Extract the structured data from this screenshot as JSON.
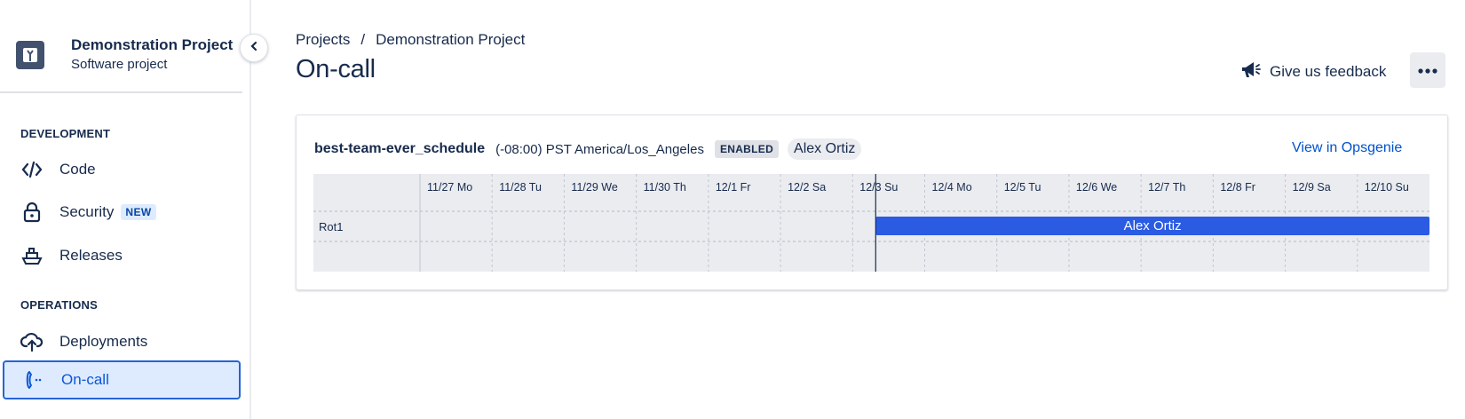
{
  "project": {
    "name": "Demonstration Project",
    "type": "Software project"
  },
  "sidebar": {
    "sections": [
      {
        "heading": "DEVELOPMENT"
      },
      {
        "heading": "OPERATIONS"
      }
    ],
    "items": [
      {
        "label": "Code",
        "icon": "code-icon"
      },
      {
        "label": "Security",
        "icon": "lock-icon",
        "badge": "NEW"
      },
      {
        "label": "Releases",
        "icon": "ship-icon"
      },
      {
        "label": "Deployments",
        "icon": "cloud-upload-icon"
      },
      {
        "label": "On-call",
        "icon": "phone-icon",
        "active": true
      }
    ]
  },
  "breadcrumb": {
    "items": [
      "Projects",
      "Demonstration Project"
    ],
    "separator": "/"
  },
  "page": {
    "title": "On-call",
    "feedback_label": "Give us feedback"
  },
  "schedule": {
    "name": "best-team-ever_schedule",
    "timezone": "(-08:00) PST America/Los_Angeles",
    "status": "ENABLED",
    "on_call_person": "Alex Ortiz",
    "link_label": "View in Opsgenie",
    "days": [
      "11/27 Mo",
      "11/28 Tu",
      "11/29 We",
      "11/30 Th",
      "12/1 Fr",
      "12/2 Sa",
      "12/3 Su",
      "12/4 Mo",
      "12/5 Tu",
      "12/6 We",
      "12/7 Th",
      "12/8 Fr",
      "12/9 Sa",
      "12/10 Su"
    ],
    "rotation": {
      "name": "Rot1",
      "assignee": "Alex Ortiz",
      "start_day": "12/3 Su"
    }
  },
  "colors": {
    "accent": "#2663d6",
    "rotation_bar": "#2a5be2",
    "link": "#0052cc",
    "active_bg": "#deebff"
  }
}
